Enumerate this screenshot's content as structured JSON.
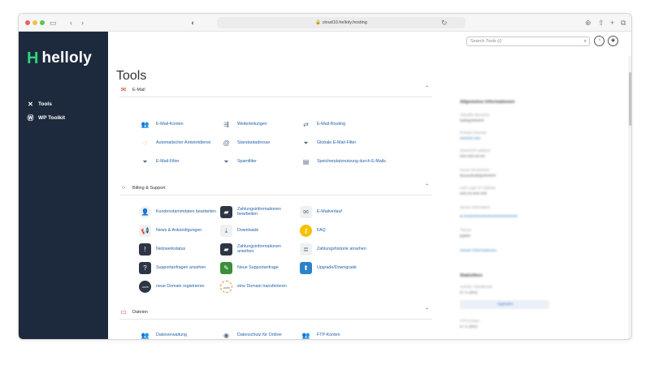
{
  "browser": {
    "url": "cloud10.helloly.hosting"
  },
  "sidebar": {
    "logo_text": "helloly",
    "items": [
      {
        "label": "Tools",
        "icon": "wrench-icon"
      },
      {
        "label": "WP Toolkit",
        "icon": "wordpress-icon"
      }
    ]
  },
  "header": {
    "search_placeholder": "Search Tools (/)",
    "page_title": "Tools"
  },
  "sections": [
    {
      "label": "E-Mail",
      "tools": [
        {
          "label": "E-Mail-Konten"
        },
        {
          "label": "Weiterleitungen"
        },
        {
          "label": "E-Mail-Routing"
        },
        {
          "label": "Automatischer Antwortdienst"
        },
        {
          "label": "Standardadresse"
        },
        {
          "label": "Globale E-Mail-Filter"
        },
        {
          "label": "E-Mail-Filter"
        },
        {
          "label": "Spamfilter"
        },
        {
          "label": "Speicherplatznutzung durch E-Mails"
        }
      ]
    },
    {
      "label": "Billing & Support",
      "tools": [
        {
          "label": "Kundenstammdaten bearbeiten"
        },
        {
          "label": "Zahlungsinformationen bearbeiten"
        },
        {
          "label": "E-Mailverlauf"
        },
        {
          "label": "News & Ankündigungen"
        },
        {
          "label": "Downloads"
        },
        {
          "label": "FAQ"
        },
        {
          "label": "Netzwerkstatus"
        },
        {
          "label": "Zahlungsinformationen ansehen"
        },
        {
          "label": "Zahlungshistorie ansehen"
        },
        {
          "label": "Supportanfragen ansehen"
        },
        {
          "label": "Neue Supportanfrage"
        },
        {
          "label": "Upgrade/Downgrade"
        },
        {
          "label": "neue Domain registrieren"
        },
        {
          "label": "eine Domain transferieren"
        }
      ]
    },
    {
      "label": "Dateien",
      "tools": [
        {
          "label": "Dateiverwaltung"
        },
        {
          "label": "Datenschutz für Ordner"
        },
        {
          "label": "FTP-Konten"
        }
      ]
    }
  ],
  "right_panel": {
    "general_title": "Allgemeine Informationen",
    "stats_title": "Statistiken",
    "blurred_note": "blurred content",
    "labels": [
      "Aktueller Benutzer",
      "Primäre Domain",
      "Shared IP Address",
      "Home-Verzeichnis",
      "Last Login IP Address",
      "Server Information",
      "Theme"
    ],
    "link_label": "Server-Informationen",
    "bar_label": "Upgraden"
  },
  "colors": {
    "sidebar_bg": "#1d2a3d",
    "accent_green": "#2ed47a",
    "link_blue": "#1f5fa8"
  }
}
